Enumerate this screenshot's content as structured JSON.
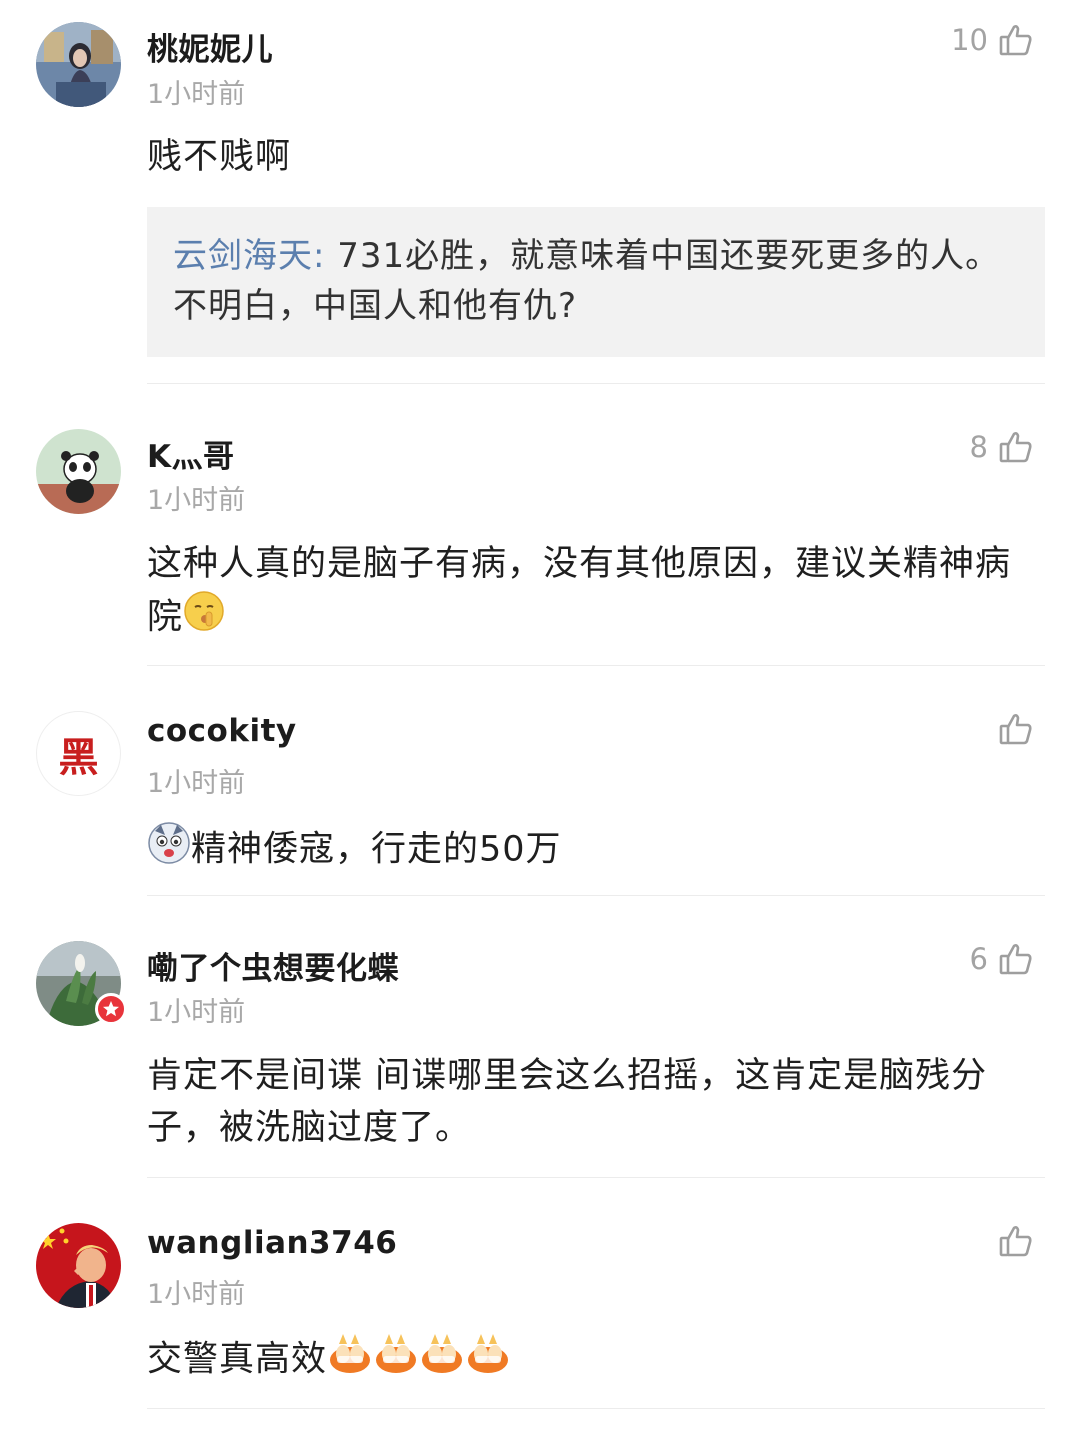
{
  "colors": {
    "time": "#a8a8a8",
    "quote_name": "#5b7fae",
    "quote_bg": "#f2f2f2",
    "badge": "#e8343b"
  },
  "comments": [
    {
      "user": "桃妮妮儿",
      "time": "1小时前",
      "likes": "10",
      "text": "贱不贱啊",
      "quote": {
        "name": "云剑海天",
        "sep": ":",
        "text": " 731必胜，就意味着中国还要死更多的人。不明白，中国人和他有仇?"
      }
    },
    {
      "user": "K灬哥",
      "time": "1小时前",
      "likes": "8",
      "text": "这种人真的是脑子有病，没有其他原因，建议关精神病院",
      "emoji": "shush-face-emoji"
    },
    {
      "user": "cocokity",
      "avatar_text": "黑",
      "time": "1小时前",
      "likes": "",
      "text": "精神倭寇，行走的50万",
      "emoji": "husky-emoji"
    },
    {
      "user": "嘞了个虫想要化蝶",
      "time": "1小时前",
      "likes": "6",
      "text": "肯定不是间谍  间谍哪里会这么招摇，这肯定是脑残分子，被洗脑过度了。",
      "badge": "verified-badge"
    },
    {
      "user": "wanglian3746",
      "time": "1小时前",
      "likes": "",
      "text": "交警真高效",
      "emoji": "clap-emoji"
    }
  ]
}
